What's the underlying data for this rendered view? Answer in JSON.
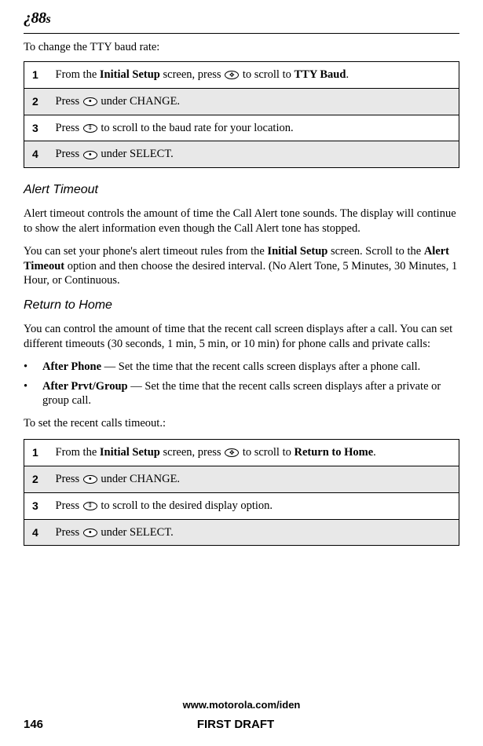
{
  "header": {
    "logo": "¿88",
    "logo_suffix": "s"
  },
  "intro1": "To change the TTY baud rate:",
  "table1": {
    "rows": [
      {
        "n": "1",
        "pre": "From the ",
        "b1": "Initial Setup",
        "mid": " screen, press ",
        "icon": "nav",
        "post": " to scroll to ",
        "b2": "TTY Baud",
        "end": "."
      },
      {
        "n": "2",
        "pre": "Press ",
        "icon": "dot",
        "post": " under CHANGE."
      },
      {
        "n": "3",
        "pre": "Press ",
        "icon": "updown",
        "post": " to scroll to the baud rate for your location."
      },
      {
        "n": "4",
        "pre": "Press ",
        "icon": "dot",
        "post": " under SELECT."
      }
    ]
  },
  "section1": {
    "heading": "Alert Timeout",
    "p1": "Alert timeout controls the amount of time the Call Alert tone sounds. The display will continue to show the alert information even though the Call Alert tone has stopped.",
    "p2a": "You can set your phone's alert timeout rules from the ",
    "p2b": "Initial Setup",
    "p2c": " screen. Scroll to the ",
    "p2d": "Alert Timeout",
    "p2e": " option and then choose the desired interval. (No Alert Tone, 5 Minutes, 30 Minutes, 1 Hour, or Continuous."
  },
  "section2": {
    "heading": "Return to Home",
    "p1": "You can control the amount of time that the recent call screen displays after a call. You can set different timeouts (30 seconds, 1 min, 5 min, or 10 min) for phone calls and private calls:",
    "bul1b": "After Phone",
    "bul1t": " — Set the time that the recent calls screen displays after a phone call.",
    "bul2b": "After Prvt/Group",
    "bul2t": " — Set the time that the recent calls screen displays after a private or group call.",
    "p2": "To set the recent calls timeout.:"
  },
  "table2": {
    "rows": [
      {
        "n": "1",
        "pre": "From the ",
        "b1": "Initial Setup",
        "mid": " screen, press ",
        "icon": "nav",
        "post": " to scroll to ",
        "b2": "Return to Home",
        "end": "."
      },
      {
        "n": "2",
        "pre": "Press ",
        "icon": "dot",
        "post": " under CHANGE."
      },
      {
        "n": "3",
        "pre": "Press ",
        "icon": "updown",
        "post": " to scroll to the desired display option."
      },
      {
        "n": "4",
        "pre": "Press ",
        "icon": "dot",
        "post": " under SELECT."
      }
    ]
  },
  "footer": {
    "url": "www.motorola.com/iden",
    "page": "146",
    "status": "FIRST DRAFT"
  }
}
